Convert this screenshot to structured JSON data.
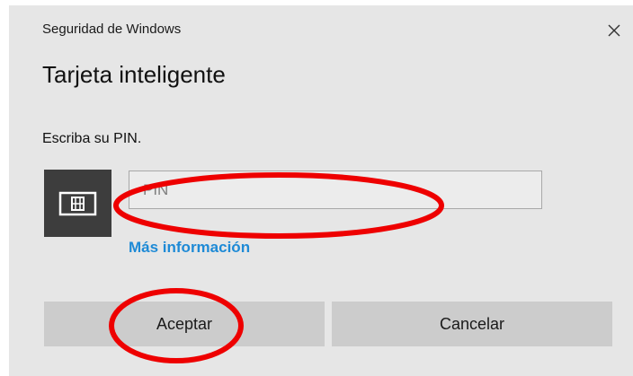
{
  "window": {
    "title": "Seguridad de Windows",
    "close_icon": "close-icon",
    "background": "#e6e6e6"
  },
  "dialog": {
    "heading": "Tarjeta inteligente",
    "prompt": "Escriba su PIN.",
    "card_icon": "smart-card-icon",
    "pin_field": {
      "placeholder": "PIN",
      "value": ""
    },
    "more_info_link": "Más información",
    "link_color": "#1e8ad6"
  },
  "buttons": {
    "ok_label": "Aceptar",
    "cancel_label": "Cancelar"
  },
  "annotations": {
    "color": "#ee0000",
    "highlighted": [
      "pin-input",
      "ok-button"
    ]
  }
}
